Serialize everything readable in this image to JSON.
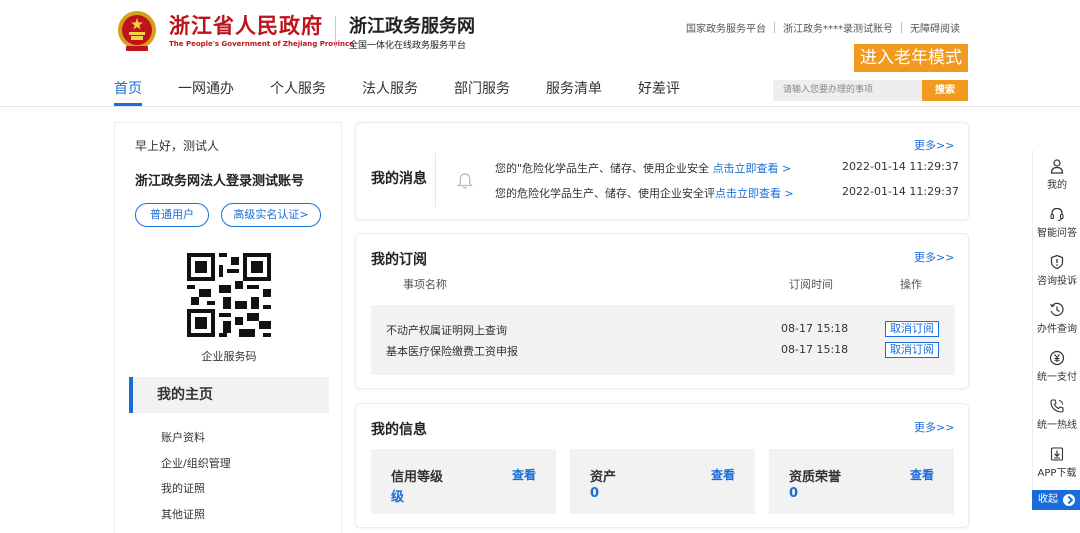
{
  "header": {
    "brand_title": "浙江省人民政府",
    "brand_subtitle": "The People's Government of Zhejiang Province",
    "service_title": "浙江政务服务网",
    "service_subtitle": "全国一体化在线政务服务平台",
    "top_links": [
      "国家政务服务平台",
      "浙江政务****录测试账号",
      "无障碍阅读"
    ],
    "elder_mode_label": "进入老年模式",
    "nav": [
      "首页",
      "一网通办",
      "个人服务",
      "法人服务",
      "部门服务",
      "服务清单",
      "好差评"
    ],
    "search_placeholder": "请输入您要办理的事项",
    "search_button": "搜索"
  },
  "left": {
    "greeting": "早上好，测试人",
    "account_name": "浙江政务网法人登录测试账号",
    "badge_normal": "普通用户",
    "badge_auth": "高级实名认证>",
    "qr_label": "企业服务码",
    "section_title": "我的主页",
    "menu": [
      "账户资料",
      "企业/组织管理",
      "我的证照",
      "其他证照"
    ]
  },
  "messages": {
    "title": "我的消息",
    "more": "更多>>",
    "items": [
      {
        "text": "您的\"危险化学品生产、储存、使用企业安全",
        "link": "点击立即查看 >",
        "time": "2022-01-14 11:29:37"
      },
      {
        "text": "您的危险化学品生产、储存、使用企业安全评",
        "link": "点击立即查看 >",
        "time": "2022-01-14 11:29:37"
      }
    ]
  },
  "subscriptions": {
    "title": "我的订阅",
    "more": "更多>>",
    "col_name": "事项名称",
    "col_time": "订阅时间",
    "col_action": "操作",
    "rows": [
      {
        "name": "不动产权属证明网上查询",
        "time": "08-17 15:18",
        "action": "取消订阅"
      },
      {
        "name": "基本医疗保险缴费工资申报",
        "time": "08-17 15:18",
        "action": "取消订阅"
      }
    ]
  },
  "info": {
    "title": "我的信息",
    "more": "更多>>",
    "boxes": [
      {
        "label": "信用等级",
        "value": "级",
        "link": "查看"
      },
      {
        "label": "资产",
        "value": "0",
        "link": "查看"
      },
      {
        "label": "资质荣誉",
        "value": "0",
        "link": "查看"
      }
    ]
  },
  "toolbar": {
    "items": [
      {
        "label": "我的",
        "icon": "user-icon"
      },
      {
        "label": "智能问答",
        "icon": "headset-icon"
      },
      {
        "label": "咨询投诉",
        "icon": "shield-icon"
      },
      {
        "label": "办件查询",
        "icon": "history-icon"
      },
      {
        "label": "统一支付",
        "icon": "yuan-icon"
      },
      {
        "label": "统一热线",
        "icon": "phone-icon"
      },
      {
        "label": "APP下载",
        "icon": "download-icon"
      }
    ],
    "collapse_label": "收起"
  },
  "colors": {
    "accent": "#1a6dd9",
    "brand_red": "#c0121b",
    "orange": "#f29a1f"
  }
}
